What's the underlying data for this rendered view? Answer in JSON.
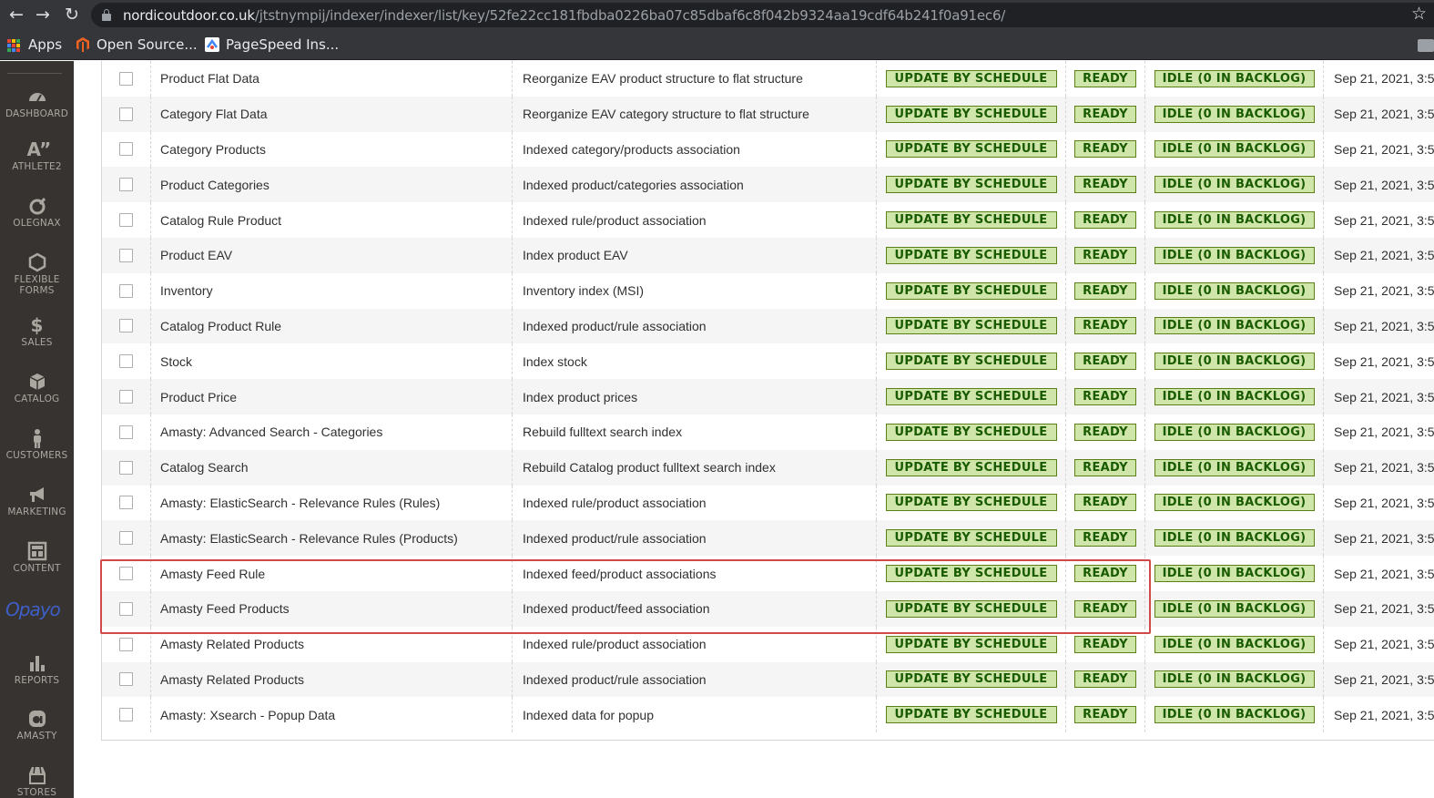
{
  "browser": {
    "url_host": "nordicoutdoor.co.uk",
    "url_path": "/jtstnympij/indexer/indexer/list/key/52fe22cc181fbdba0226ba07c85dbaf6c8f042b9324aa19cdf64b241f0a91ec6/",
    "bookmarks": [
      "Apps",
      "Open Source...",
      "PageSpeed Ins..."
    ]
  },
  "sidebar": {
    "items": [
      {
        "label": "DASHBOARD",
        "icon": "dashboard-icon"
      },
      {
        "label": "ATHLETE2",
        "icon": "athlete2-icon"
      },
      {
        "label": "OLEGNAX",
        "icon": "olegnax-icon"
      },
      {
        "label": "FLEXIBLE FORMS",
        "icon": "flexible-forms-icon"
      },
      {
        "label": "SALES",
        "icon": "dollar-icon"
      },
      {
        "label": "CATALOG",
        "icon": "box-icon"
      },
      {
        "label": "CUSTOMERS",
        "icon": "person-icon"
      },
      {
        "label": "MARKETING",
        "icon": "megaphone-icon"
      },
      {
        "label": "CONTENT",
        "icon": "layout-icon"
      },
      {
        "label": "REPORTS",
        "icon": "bar-chart-icon"
      },
      {
        "label": "AMASTY",
        "icon": "amasty-icon"
      },
      {
        "label": "STORES",
        "icon": "store-icon"
      }
    ],
    "opayo_logo": "Opayo"
  },
  "grid": {
    "rows": [
      {
        "title": "Product Flat Data",
        "description": "Reorganize EAV product structure to flat structure",
        "mode": "UPDATE BY SCHEDULE",
        "status": "READY",
        "schedule": "IDLE (0 IN BACKLOG)",
        "updated": "Sep 21, 2021, 3:5"
      },
      {
        "title": "Category Flat Data",
        "description": "Reorganize EAV category structure to flat structure",
        "mode": "UPDATE BY SCHEDULE",
        "status": "READY",
        "schedule": "IDLE (0 IN BACKLOG)",
        "updated": "Sep 21, 2021, 3:5"
      },
      {
        "title": "Category Products",
        "description": "Indexed category/products association",
        "mode": "UPDATE BY SCHEDULE",
        "status": "READY",
        "schedule": "IDLE (0 IN BACKLOG)",
        "updated": "Sep 21, 2021, 3:5"
      },
      {
        "title": "Product Categories",
        "description": "Indexed product/categories association",
        "mode": "UPDATE BY SCHEDULE",
        "status": "READY",
        "schedule": "IDLE (0 IN BACKLOG)",
        "updated": "Sep 21, 2021, 3:5"
      },
      {
        "title": "Catalog Rule Product",
        "description": "Indexed rule/product association",
        "mode": "UPDATE BY SCHEDULE",
        "status": "READY",
        "schedule": "IDLE (0 IN BACKLOG)",
        "updated": "Sep 21, 2021, 3:5"
      },
      {
        "title": "Product EAV",
        "description": "Index product EAV",
        "mode": "UPDATE BY SCHEDULE",
        "status": "READY",
        "schedule": "IDLE (0 IN BACKLOG)",
        "updated": "Sep 21, 2021, 3:5"
      },
      {
        "title": "Inventory",
        "description": "Inventory index (MSI)",
        "mode": "UPDATE BY SCHEDULE",
        "status": "READY",
        "schedule": "IDLE (0 IN BACKLOG)",
        "updated": "Sep 21, 2021, 3:5"
      },
      {
        "title": "Catalog Product Rule",
        "description": "Indexed product/rule association",
        "mode": "UPDATE BY SCHEDULE",
        "status": "READY",
        "schedule": "IDLE (0 IN BACKLOG)",
        "updated": "Sep 21, 2021, 3:5"
      },
      {
        "title": "Stock",
        "description": "Index stock",
        "mode": "UPDATE BY SCHEDULE",
        "status": "READY",
        "schedule": "IDLE (0 IN BACKLOG)",
        "updated": "Sep 21, 2021, 3:5"
      },
      {
        "title": "Product Price",
        "description": "Index product prices",
        "mode": "UPDATE BY SCHEDULE",
        "status": "READY",
        "schedule": "IDLE (0 IN BACKLOG)",
        "updated": "Sep 21, 2021, 3:5"
      },
      {
        "title": "Amasty: Advanced Search - Categories",
        "description": "Rebuild fulltext search index",
        "mode": "UPDATE BY SCHEDULE",
        "status": "READY",
        "schedule": "IDLE (0 IN BACKLOG)",
        "updated": "Sep 21, 2021, 3:5"
      },
      {
        "title": "Catalog Search",
        "description": "Rebuild Catalog product fulltext search index",
        "mode": "UPDATE BY SCHEDULE",
        "status": "READY",
        "schedule": "IDLE (0 IN BACKLOG)",
        "updated": "Sep 21, 2021, 3:5"
      },
      {
        "title": "Amasty: ElasticSearch - Relevance Rules (Rules)",
        "description": "Indexed rule/product association",
        "mode": "UPDATE BY SCHEDULE",
        "status": "READY",
        "schedule": "IDLE (0 IN BACKLOG)",
        "updated": "Sep 21, 2021, 3:5"
      },
      {
        "title": "Amasty: ElasticSearch - Relevance Rules (Products)",
        "description": "Indexed product/rule association",
        "mode": "UPDATE BY SCHEDULE",
        "status": "READY",
        "schedule": "IDLE (0 IN BACKLOG)",
        "updated": "Sep 21, 2021, 3:5"
      },
      {
        "title": "Amasty Feed Rule",
        "description": "Indexed feed/product associations",
        "mode": "UPDATE BY SCHEDULE",
        "status": "READY",
        "schedule": "IDLE (0 IN BACKLOG)",
        "updated": "Sep 21, 2021, 3:5"
      },
      {
        "title": "Amasty Feed Products",
        "description": "Indexed product/feed association",
        "mode": "UPDATE BY SCHEDULE",
        "status": "READY",
        "schedule": "IDLE (0 IN BACKLOG)",
        "updated": "Sep 21, 2021, 3:5"
      },
      {
        "title": "Amasty Related Products",
        "description": "Indexed rule/product association",
        "mode": "UPDATE BY SCHEDULE",
        "status": "READY",
        "schedule": "IDLE (0 IN BACKLOG)",
        "updated": "Sep 21, 2021, 3:5"
      },
      {
        "title": "Amasty Related Products",
        "description": "Indexed product/rule association",
        "mode": "UPDATE BY SCHEDULE",
        "status": "READY",
        "schedule": "IDLE (0 IN BACKLOG)",
        "updated": "Sep 21, 2021, 3:5"
      },
      {
        "title": "Amasty: Xsearch - Popup Data",
        "description": "Indexed data for popup",
        "mode": "UPDATE BY SCHEDULE",
        "status": "READY",
        "schedule": "IDLE (0 IN BACKLOG)",
        "updated": "Sep 21, 2021, 3:5"
      }
    ]
  },
  "colors": {
    "badge_bg": "#d0e5a9",
    "badge_border": "#5b8116",
    "badge_text": "#185b00",
    "highlight_border": "#d04a4a",
    "sidebar_bg": "#373330"
  }
}
